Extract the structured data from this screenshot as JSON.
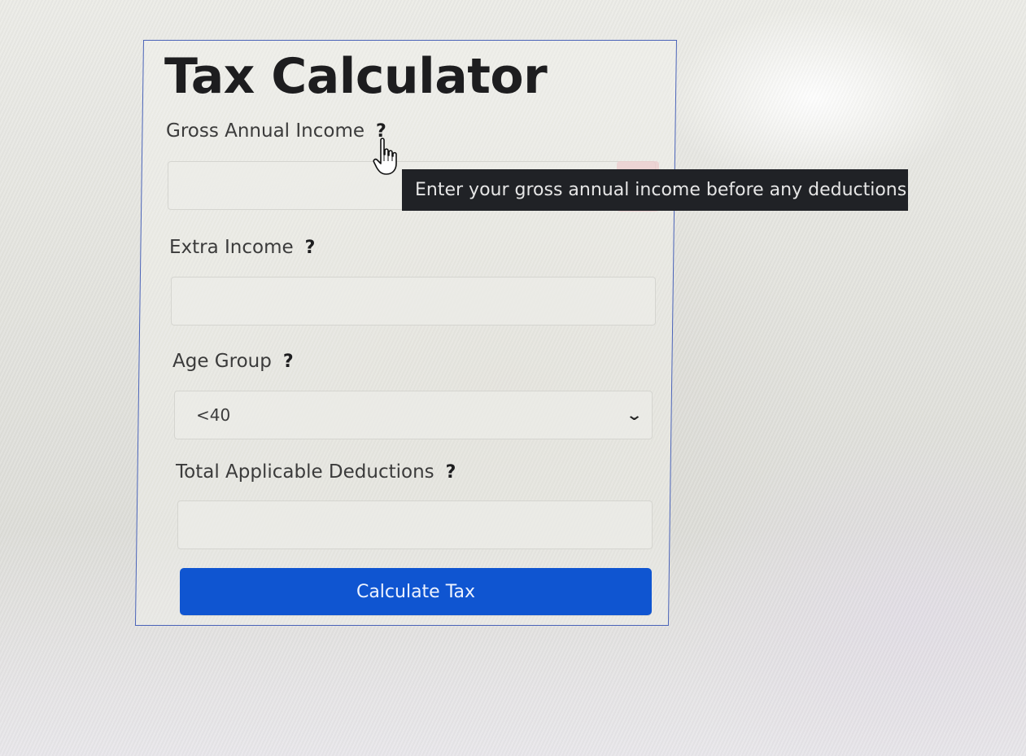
{
  "page": {
    "title": "Tax Calculator"
  },
  "form": {
    "gross_income": {
      "label": "Gross Annual Income",
      "help": "?",
      "value": "",
      "placeholder": ""
    },
    "extra_income": {
      "label": "Extra Income",
      "help": "?",
      "value": "",
      "placeholder": ""
    },
    "age_group": {
      "label": "Age Group",
      "help": "?",
      "selected": "<40"
    },
    "deductions": {
      "label": "Total Applicable Deductions",
      "help": "?",
      "value": "",
      "placeholder": ""
    },
    "submit_label": "Calculate Tax"
  },
  "tooltip": {
    "text": "Enter your gross annual income before any deductions."
  },
  "icons": {
    "cursor": "hand-pointer-icon",
    "select_arrow": "chevron-down-icon"
  },
  "colors": {
    "accent": "#0f55d1",
    "card_border": "#4a63b8",
    "tooltip_bg": "#202226",
    "error_tint": "#eccccd"
  }
}
